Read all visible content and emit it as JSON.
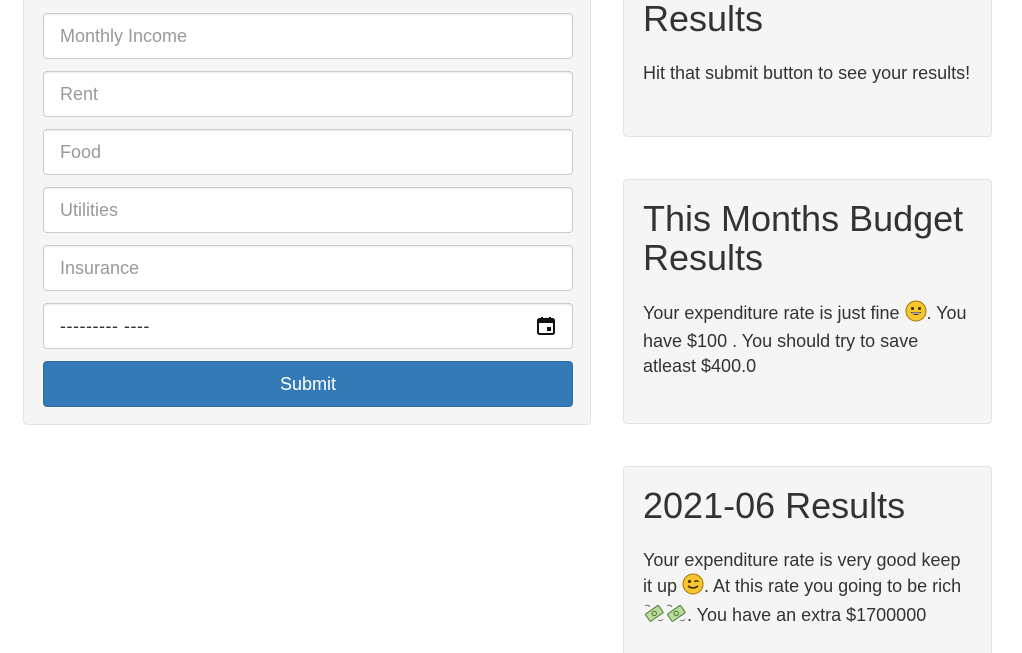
{
  "form": {
    "income_placeholder": "Monthly Income",
    "rent_placeholder": "Rent",
    "food_placeholder": "Food",
    "utilities_placeholder": "Utilities",
    "insurance_placeholder": "Insurance",
    "date_value": "--------- ----",
    "submit_label": "Submit"
  },
  "results": [
    {
      "title": "Results",
      "text_1": "Hit that submit button to see your results!"
    },
    {
      "title": "This Months Budget Results",
      "text_1": "Your expenditure rate is just fine ",
      "text_2": ". You have $100 . You should try to save atleast $400.0",
      "emoji": "grinning-face"
    },
    {
      "title": "2021-06 Results",
      "text_1": "Your expenditure rate is very good keep it up ",
      "text_2": ". At this rate you going to be rich ",
      "text_3": ". You have an extra $1700000",
      "emoji_1": "winking-face",
      "emoji_2": "money-with-wings"
    }
  ],
  "colors": {
    "primary": "#337ab7",
    "card_bg": "#f5f5f5",
    "text": "#333333"
  }
}
